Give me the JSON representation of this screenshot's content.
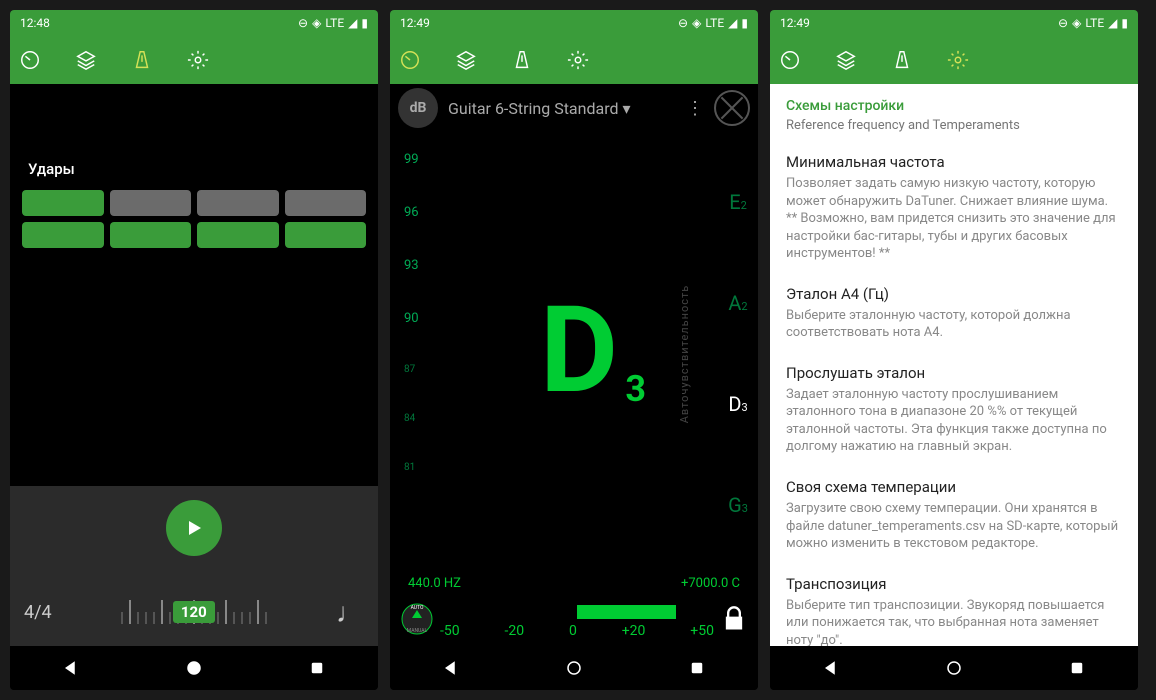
{
  "statusbar": {
    "time1": "12:48",
    "time2": "12:49",
    "time3": "12:49",
    "net": "LTE"
  },
  "screen1": {
    "beats_label": "Удары",
    "time_sig": "4/4",
    "bpm": "120"
  },
  "screen2": {
    "db": "dB",
    "tuning": "Guitar 6-String Standard",
    "scale": [
      "99",
      "96",
      "93",
      "90",
      "87",
      "84",
      "81"
    ],
    "note": "D",
    "note_sub": "3",
    "side_notes": [
      {
        "n": "E",
        "s": "2"
      },
      {
        "n": "A",
        "s": "2"
      },
      {
        "n": "D",
        "s": "3"
      },
      {
        "n": "G",
        "s": "3"
      }
    ],
    "freq": "440.0 HZ",
    "cents": "+7000.0 C",
    "auto_label": "Авточувствительность",
    "cent_labels": [
      "-50",
      "-20",
      "0",
      "+20",
      "+50"
    ]
  },
  "screen3": {
    "section_title": "Схемы настройки",
    "section_sub": "Reference frequency and Temperaments",
    "items": [
      {
        "t": "Минимальная частота",
        "d": "Позволяет задать самую низкую частоту, которую может обнаружить DaTuner. Снижает влияние шума. ** Возможно, вам придется снизить это значение для настройки бас-гитары, тубы и других басовых инструментов! **"
      },
      {
        "t": "Эталон A4 (Гц)",
        "d": "Выберите эталонную частоту, которой должна соответствовать нота A4."
      },
      {
        "t": "Прослушать эталон",
        "d": "Задает эталонную частоту прослушиванием эталонного тона в диапазоне 20 %% от текущей эталонной частоты. Эта функция также доступна по долгому нажатию на главный экран."
      },
      {
        "t": "Своя схема темперации",
        "d": "Загрузите свою схему темперации. Они хранятся в файле datuner_temperaments.csv на SD-карте, который можно изменить в текстовом редакторе."
      },
      {
        "t": "Транспозиция",
        "d": "Выберите тип транспозиции. Звукоряд повышается или понижается так, что выбранная нота заменяет ноту \"до\"."
      }
    ]
  }
}
